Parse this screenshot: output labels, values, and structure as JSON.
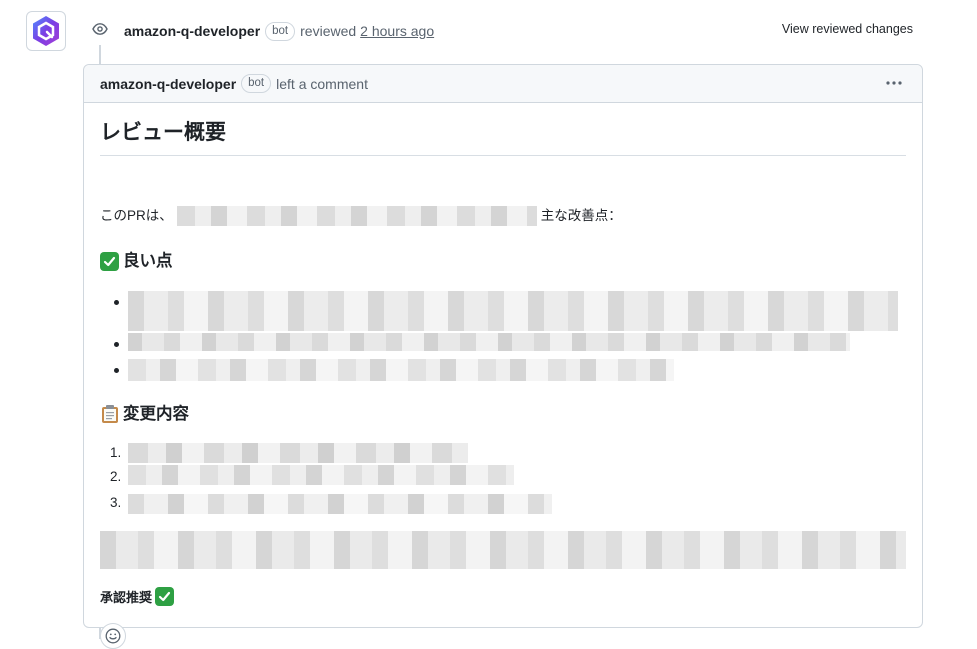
{
  "review": {
    "author": "amazon-q-developer",
    "badge": "bot",
    "action": "reviewed",
    "time": "2 hours ago",
    "view_changes_label": "View reviewed changes"
  },
  "comment": {
    "author": "amazon-q-developer",
    "badge": "bot",
    "action": "left a comment",
    "heading": "レビュー概要",
    "summary_prefix": "このPRは、",
    "summary_suffix": "主な改善点：",
    "good_points_heading": "良い点",
    "changes_heading": "変更内容",
    "change_numbers": [
      "1.",
      "2.",
      "3."
    ],
    "approval": "承認推奨"
  },
  "icons": {
    "avatar": "amazon-q-logo-icon",
    "review": "eye-icon",
    "more": "kebab-horizontal-icon",
    "good": "check-mark-emoji-icon",
    "changes": "clipboard-emoji-icon",
    "reaction": "smiley-icon"
  },
  "colors": {
    "accent_purple": "#6b2ee3",
    "emoji_green": "#2ea043",
    "border": "#d0d7de",
    "header_bg": "#f6f8fa"
  }
}
